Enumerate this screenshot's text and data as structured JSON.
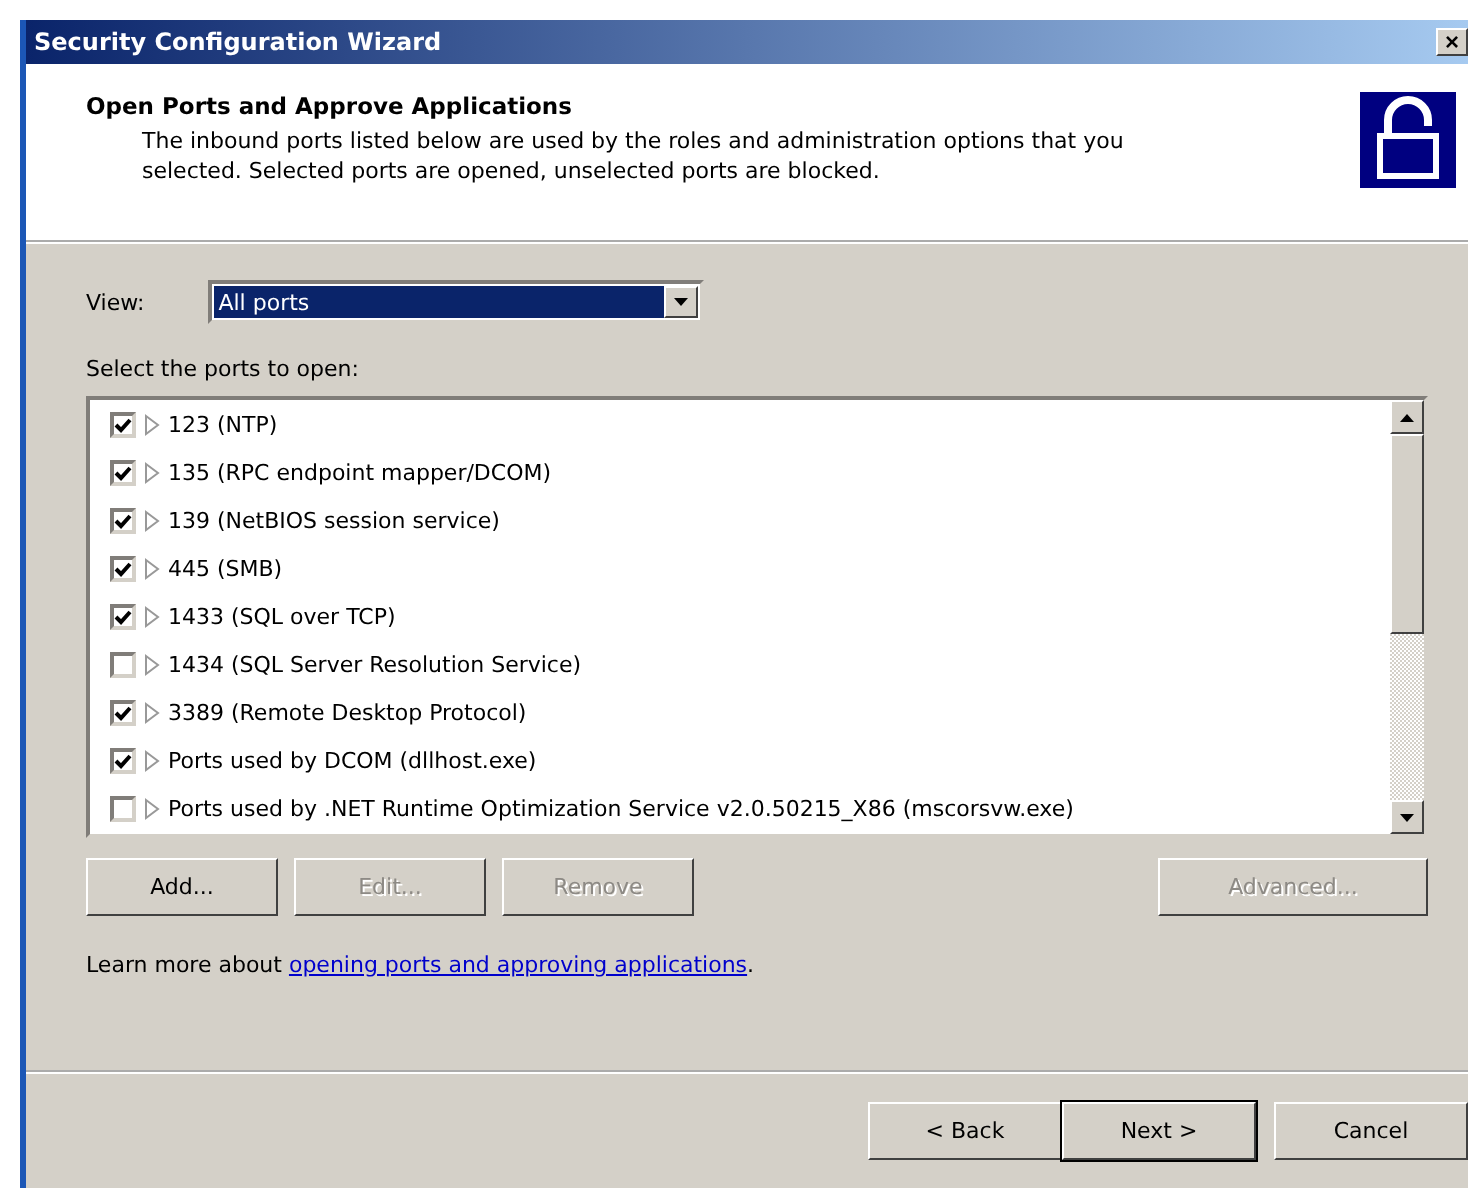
{
  "window": {
    "title": "Security Configuration Wizard",
    "close": "×"
  },
  "header": {
    "title": "Open Ports and Approve Applications",
    "description": "The inbound ports listed below are used by the roles and administration options that you selected. Selected ports are opened, unselected ports are blocked."
  },
  "view": {
    "label": "View:",
    "value": "All ports"
  },
  "ports_label": "Select the ports to open:",
  "ports": [
    {
      "label": "123 (NTP)",
      "checked": true
    },
    {
      "label": "135 (RPC endpoint mapper/DCOM)",
      "checked": true
    },
    {
      "label": "139 (NetBIOS session service)",
      "checked": true
    },
    {
      "label": "445 (SMB)",
      "checked": true
    },
    {
      "label": "1433 (SQL over TCP)",
      "checked": true
    },
    {
      "label": "1434 (SQL Server Resolution Service)",
      "checked": false
    },
    {
      "label": "3389 (Remote Desktop Protocol)",
      "checked": true
    },
    {
      "label": "Ports used by DCOM (dllhost.exe)",
      "checked": true
    },
    {
      "label": "Ports used by .NET Runtime Optimization Service v2.0.50215_X86 (mscorsvw.exe)",
      "checked": false
    }
  ],
  "list_buttons": [
    {
      "label": "Add...",
      "disabled": false
    },
    {
      "label": "Edit...",
      "disabled": true
    },
    {
      "label": "Remove",
      "disabled": true
    },
    {
      "label": "Advanced...",
      "disabled": true
    }
  ],
  "learn_more": {
    "text": "Learn more about ",
    "link": "opening ports and approving applications",
    "end": "."
  },
  "nav_buttons": [
    {
      "label": "< Back",
      "default": false
    },
    {
      "label": "Next >",
      "default": true
    },
    {
      "label": "Cancel",
      "default": false
    }
  ]
}
